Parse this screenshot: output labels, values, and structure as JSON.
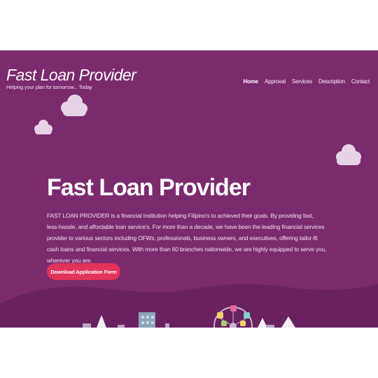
{
  "brand": {
    "title": "Fast Loan Provider",
    "tagline": "Helping your plan for tomorrow... Today"
  },
  "nav": {
    "items": [
      {
        "label": "Home"
      },
      {
        "label": "Approval"
      },
      {
        "label": "Services"
      },
      {
        "label": "Description"
      },
      {
        "label": "Contact"
      }
    ],
    "active": "Home"
  },
  "hero": {
    "title": "Fast Loan Provider",
    "text": "FAST LOAN PROVIDER is a financial institution helping Filipino's to achieved their goals. By providing fast, less-hassle, and affordable loan service's. For more than a decade, we have been the leading financial services provider to various sectors including OFWs, professionals, business owners, and executives, offering tailor-fit cash loans and financial services. With more than 60 branches nationwide, we are highly equipped to serve you, wherever you are.",
    "cta_label": "Download Application Form"
  },
  "colors": {
    "background": "#7b2a6e",
    "cta": "#e2335a",
    "cloud": "#e6d3e6",
    "hill": "#6a2160"
  },
  "icons": [
    "cloud-icon",
    "ferris-wheel-icon",
    "building-icon",
    "tree-icon"
  ]
}
